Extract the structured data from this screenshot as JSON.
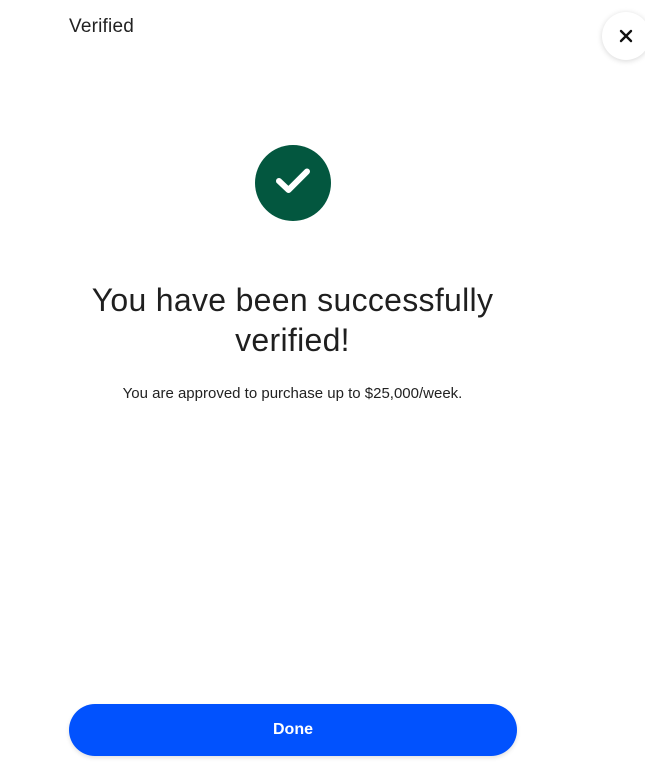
{
  "header": {
    "title": "Verified",
    "close_icon": "close-icon"
  },
  "main": {
    "status_icon": "checkmark-icon",
    "heading": "You have been successfully verified!",
    "message": "You are approved to purchase up to $25,000/week."
  },
  "footer": {
    "done_label": "Done"
  },
  "colors": {
    "success": "#03573f",
    "primary": "#0152fe"
  }
}
